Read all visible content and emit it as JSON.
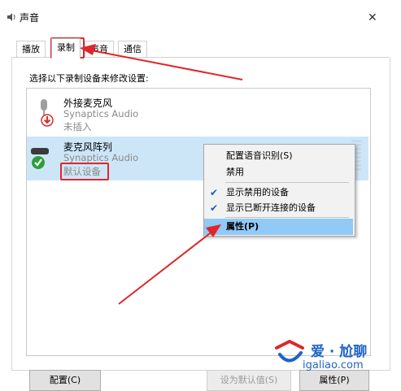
{
  "window": {
    "title": "声音"
  },
  "tabs": [
    {
      "label": "播放",
      "active": false
    },
    {
      "label": "录制",
      "active": true
    },
    {
      "label": "声音",
      "active": false
    },
    {
      "label": "通信",
      "active": false
    }
  ],
  "instruction": "选择以下录制设备来修改设置:",
  "devices": [
    {
      "name": "外接麦克风",
      "driver": "Synaptics Audio",
      "status": "未插入"
    },
    {
      "name": "麦克风阵列",
      "driver": "Synaptics Audio",
      "status": "默认设备"
    }
  ],
  "context_menu": {
    "items": [
      {
        "label": "配置语音识别(S)",
        "checked": false
      },
      {
        "label": "禁用",
        "checked": false
      },
      {
        "label": "显示禁用的设备",
        "checked": true
      },
      {
        "label": "显示已断开连接的设备",
        "checked": true
      },
      {
        "label": "属性(P)",
        "checked": false,
        "highlighted": true
      }
    ]
  },
  "buttons": {
    "configure": "配置(C)",
    "set_default": "设为默认值(S)",
    "properties": "属性(P)"
  },
  "watermark": {
    "brand": "爱 · 尬聊",
    "url": "igaliao.com"
  },
  "colors": {
    "selection": "#cde6f7",
    "menu_highlight": "#91c9f7",
    "annotation_red": "#e0262a",
    "default_check": "#2e9e3a"
  }
}
